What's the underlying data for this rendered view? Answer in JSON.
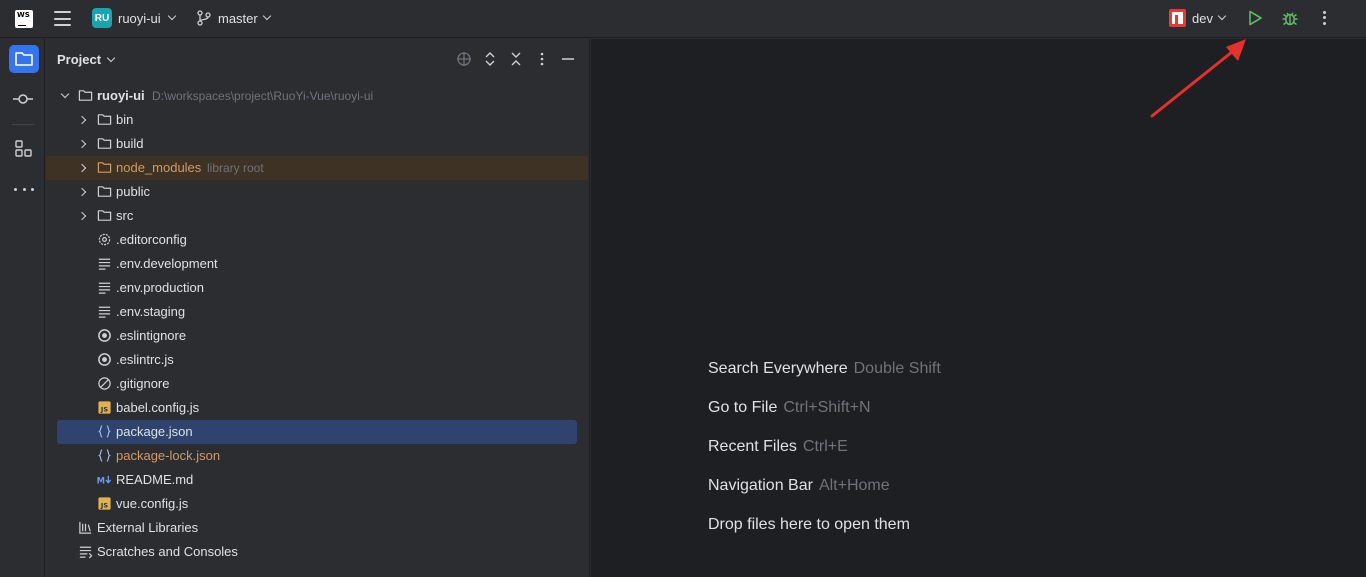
{
  "topbar": {
    "app_logo_text": "WS",
    "project_badge": "RU",
    "project_name": "ruoyi-ui",
    "branch": "master",
    "run_config": "dev"
  },
  "panel": {
    "title": "Project"
  },
  "tree": {
    "root": {
      "label": "ruoyi-ui",
      "path": "D:\\workspaces\\project\\RuoYi-Vue\\ruoyi-ui"
    },
    "folders": [
      {
        "label": "bin"
      },
      {
        "label": "build"
      },
      {
        "label": "node_modules",
        "hint": "library root"
      },
      {
        "label": "public"
      },
      {
        "label": "src"
      }
    ],
    "files": [
      {
        "label": ".editorconfig"
      },
      {
        "label": ".env.development"
      },
      {
        "label": ".env.production"
      },
      {
        "label": ".env.staging"
      },
      {
        "label": ".eslintignore"
      },
      {
        "label": ".eslintrc.js"
      },
      {
        "label": ".gitignore"
      },
      {
        "label": "babel.config.js"
      },
      {
        "label": "package.json"
      },
      {
        "label": "package-lock.json"
      },
      {
        "label": "README.md"
      },
      {
        "label": "vue.config.js"
      }
    ],
    "external_libraries": "External Libraries",
    "scratches": "Scratches and Consoles"
  },
  "editor": {
    "tips": [
      {
        "action": "Search Everywhere",
        "shortcut": "Double Shift"
      },
      {
        "action": "Go to File",
        "shortcut": "Ctrl+Shift+N"
      },
      {
        "action": "Recent Files",
        "shortcut": "Ctrl+E"
      },
      {
        "action": "Navigation Bar",
        "shortcut": "Alt+Home"
      },
      {
        "action": "Drop files here to open them",
        "shortcut": ""
      }
    ]
  },
  "colors": {
    "accent": "#3574f0",
    "run_green": "#5fb865",
    "annotation_red": "#e8302a",
    "library_bg": "#3d3223",
    "selection_bg": "#2e436e",
    "modified_orange": "#d19a66"
  }
}
